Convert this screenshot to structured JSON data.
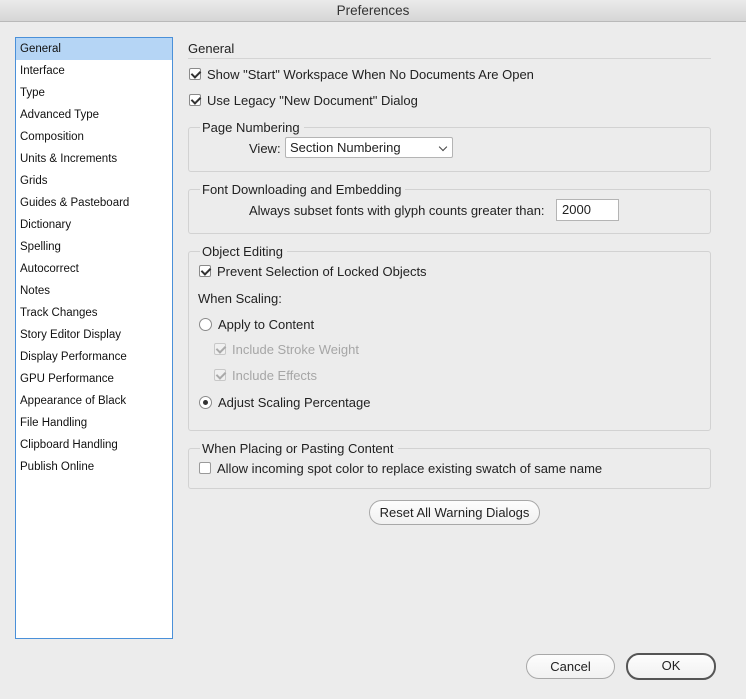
{
  "window": {
    "title": "Preferences"
  },
  "sidebar": {
    "items": [
      {
        "label": "General",
        "selected": true
      },
      {
        "label": "Interface"
      },
      {
        "label": "Type"
      },
      {
        "label": "Advanced Type"
      },
      {
        "label": "Composition"
      },
      {
        "label": "Units & Increments"
      },
      {
        "label": "Grids"
      },
      {
        "label": "Guides & Pasteboard"
      },
      {
        "label": "Dictionary"
      },
      {
        "label": "Spelling"
      },
      {
        "label": "Autocorrect"
      },
      {
        "label": "Notes"
      },
      {
        "label": "Track Changes"
      },
      {
        "label": "Story Editor Display"
      },
      {
        "label": "Display Performance"
      },
      {
        "label": "GPU Performance"
      },
      {
        "label": "Appearance of Black"
      },
      {
        "label": "File Handling"
      },
      {
        "label": "Clipboard Handling"
      },
      {
        "label": "Publish Online"
      }
    ]
  },
  "general": {
    "heading": "General",
    "show_start_workspace": {
      "label": "Show \"Start\" Workspace When No Documents Are Open",
      "checked": true
    },
    "use_legacy_new_doc": {
      "label": "Use Legacy \"New Document\" Dialog",
      "checked": true
    }
  },
  "page_numbering": {
    "title": "Page Numbering",
    "view_label": "View:",
    "view_value": "Section Numbering"
  },
  "font_downloading": {
    "title": "Font Downloading and Embedding",
    "subset_label": "Always subset fonts with glyph counts greater than:",
    "subset_value": "2000"
  },
  "object_editing": {
    "title": "Object Editing",
    "prevent_locked": {
      "label": "Prevent Selection of Locked Objects",
      "checked": true
    },
    "when_scaling_label": "When Scaling:",
    "apply_to_content": {
      "label": "Apply to Content",
      "selected": false
    },
    "include_stroke_weight": {
      "label": "Include Stroke Weight",
      "checked": true,
      "enabled": false
    },
    "include_effects": {
      "label": "Include Effects",
      "checked": true,
      "enabled": false
    },
    "adjust_scaling": {
      "label": "Adjust Scaling Percentage",
      "selected": true
    }
  },
  "placing": {
    "title": "When Placing or Pasting Content",
    "allow_spot_color": {
      "label": "Allow incoming spot color to replace existing swatch of same name",
      "checked": false
    }
  },
  "buttons": {
    "reset_warnings": "Reset All Warning Dialogs",
    "cancel": "Cancel",
    "ok": "OK"
  },
  "colors": {
    "selection": "#b5d5f5",
    "sidebar_border": "#4a90d9"
  }
}
